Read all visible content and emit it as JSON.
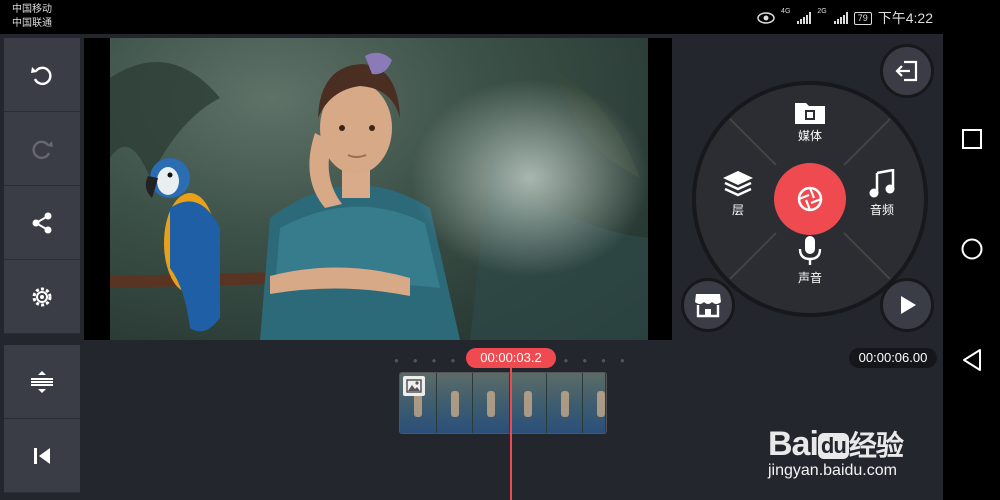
{
  "status_bar": {
    "carrier_1": "中国移动",
    "carrier_2": "中国联通",
    "network_1": "4G",
    "network_2": "2G",
    "battery": "79",
    "time": "下午4:22"
  },
  "toolbar": {
    "items": [
      {
        "icon": "undo-icon",
        "state": "enabled"
      },
      {
        "icon": "redo-icon",
        "state": "disabled"
      },
      {
        "icon": "share-icon",
        "state": "enabled"
      },
      {
        "icon": "settings-gear-icon",
        "state": "enabled"
      }
    ],
    "bottom_items": [
      {
        "icon": "adjust-tracks-icon"
      },
      {
        "icon": "skip-to-start-icon"
      }
    ]
  },
  "wheel": {
    "media_label": "媒体",
    "layer_label": "层",
    "audio_label": "音频",
    "voice_label": "声音",
    "accent_color": "#ef4a4f"
  },
  "timeline": {
    "current_time": "00:00:03.2",
    "total_time": "00:00:06.00"
  },
  "watermark": {
    "logo_bai": "Bai",
    "logo_du": "du",
    "logo_cn": "经验",
    "url": "jingyan.baidu.com"
  }
}
